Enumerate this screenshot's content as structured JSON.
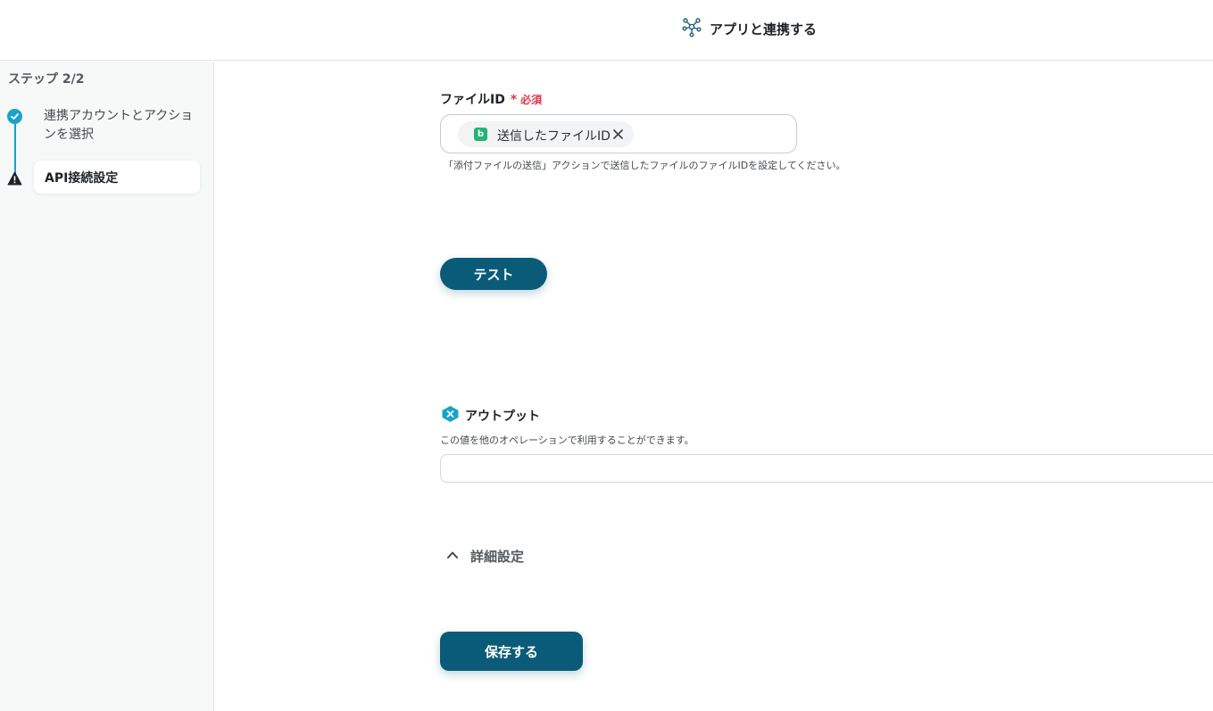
{
  "header": {
    "title": "アプリと連携する",
    "icon": "network-nodes-icon"
  },
  "sidebar": {
    "step_counter": "ステップ 2/2",
    "steps": [
      {
        "label": "連携アカウントとアクションを選択",
        "status": "completed",
        "icon": "check-circle-icon"
      },
      {
        "label": "API接続設定",
        "status": "current",
        "icon": "warning-icon"
      }
    ]
  },
  "main": {
    "file_id_field": {
      "label": "ファイルID",
      "required_star": "*",
      "required_text": "必須",
      "chip": {
        "icon_letter": "b",
        "text": "送信したファイルID",
        "icon": "app-b-icon",
        "remove_icon": "close-icon"
      },
      "help_text": "「添付ファイルの送信」アクションで送信したファイルのファイルIDを設定してください。"
    },
    "test_button": "テスト",
    "output": {
      "icon": "variable-x-icon",
      "title": "アウトプット",
      "description": "この値を他のオペレーションで利用することができます。",
      "value": ""
    },
    "advanced": {
      "label": "詳細設定",
      "icon": "chevron-up-icon"
    },
    "save_button": "保存する"
  },
  "colors": {
    "primary": "#0a5b78",
    "accent": "#1aa3c8",
    "required": "#e0364a",
    "chip_app": "#22b573"
  }
}
